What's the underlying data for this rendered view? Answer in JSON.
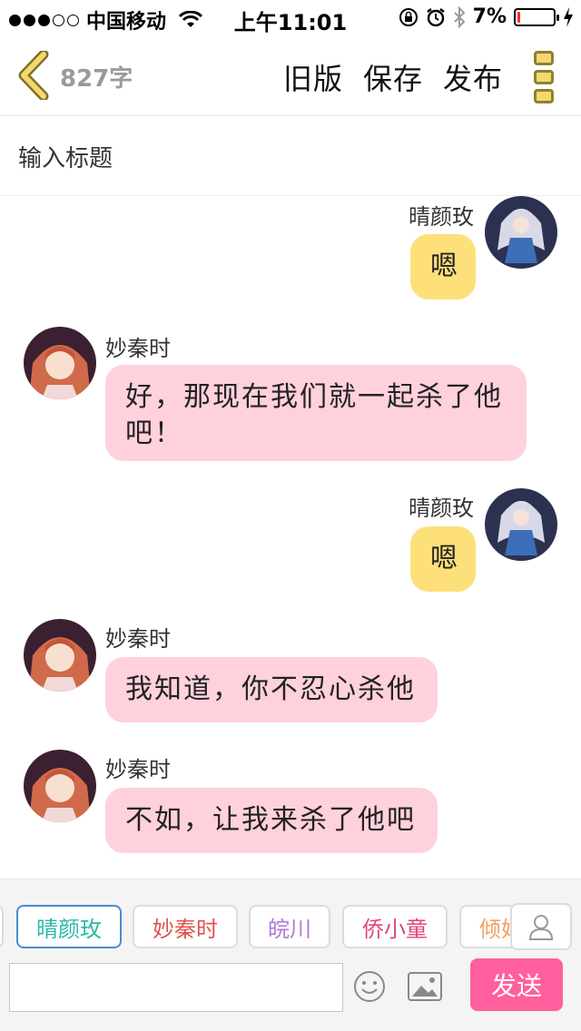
{
  "status_bar": {
    "carrier": "中国移动",
    "time": "上午11:01",
    "battery_percent": "7%",
    "battery_level": 0.07,
    "battery_color": "#ff2d2d",
    "signal_bars_on": 3,
    "icons": [
      "wifi-icon",
      "rotation-lock-icon",
      "alarm-icon",
      "bluetooth-icon",
      "charging-icon"
    ]
  },
  "nav": {
    "back_icon": "chevron-left-icon",
    "word_count": "827字",
    "actions": [
      "旧版",
      "保存",
      "发布"
    ],
    "more_icon": "more-icon"
  },
  "title": {
    "placeholder": "输入标题"
  },
  "messages": [
    {
      "speaker": "晴颜玫",
      "side": "right",
      "text": "嗯",
      "bubble_color": "#fde07a"
    },
    {
      "speaker": "妙秦时",
      "side": "left",
      "text": "好，那现在我们就一起杀了他吧！",
      "bubble_color": "#ffd1dc"
    },
    {
      "speaker": "晴颜玫",
      "side": "right",
      "text": "嗯",
      "bubble_color": "#fde07a"
    },
    {
      "speaker": "妙秦时",
      "side": "left",
      "text": "我知道，你不忍心杀他",
      "bubble_color": "#ffd1dc"
    },
    {
      "speaker": "妙秦时",
      "side": "left",
      "text": "不如，让我来杀了他吧",
      "bubble_color": "#ffd1dc"
    }
  ],
  "roles": [
    {
      "name": "晴颜玫",
      "color": "#2db8a8",
      "active": true
    },
    {
      "name": "妙秦时",
      "color": "#e0524a",
      "active": false
    },
    {
      "name": "皖川",
      "color": "#b27ad6",
      "active": false
    },
    {
      "name": "侨小童",
      "color": "#e0457a",
      "active": false
    },
    {
      "name": "倾如",
      "color": "#f0a064",
      "active": false
    }
  ],
  "roles_visible_last": "倾妁",
  "input": {
    "value": "",
    "send_label": "发送",
    "send_color": "#ff5f9c"
  },
  "colors": {
    "accent_pink": "#ff5f9c",
    "bubble_pink": "#ffd1dc",
    "bubble_yellow": "#fde07a",
    "active_chip_border": "#4a8bd6"
  }
}
